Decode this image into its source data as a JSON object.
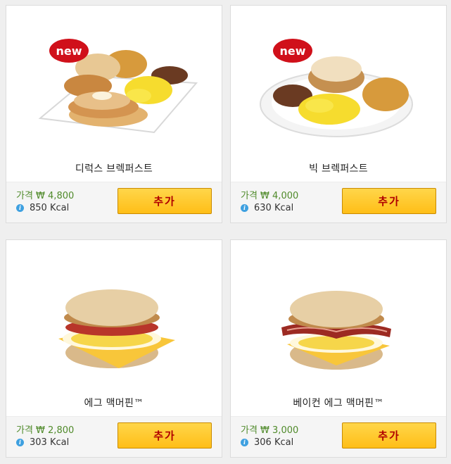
{
  "currency_prefix": "가격 ₩",
  "kcal_unit": "Kcal",
  "add_label": "추가",
  "badge_label": "new",
  "items": [
    {
      "name": "디럭스 브렉퍼스트",
      "price": "가격 ₩ 4,800",
      "kcal": "850 Kcal",
      "is_new": true
    },
    {
      "name": "빅 브렉퍼스트",
      "price": "가격 ₩ 4,000",
      "kcal": "630 Kcal",
      "is_new": true
    },
    {
      "name": "에그 맥머핀™",
      "price": "가격 ₩ 2,800",
      "kcal": "303 Kcal",
      "is_new": false
    },
    {
      "name": "베이컨 에그 맥머핀™",
      "price": "가격 ₩ 3,000",
      "kcal": "306 Kcal",
      "is_new": false
    }
  ],
  "colors": {
    "price_green": "#4f8a2a",
    "button_yellow": "#ffc21f",
    "button_text_red": "#b00000",
    "badge_red": "#d0101a",
    "info_blue": "#3ea0e0"
  }
}
